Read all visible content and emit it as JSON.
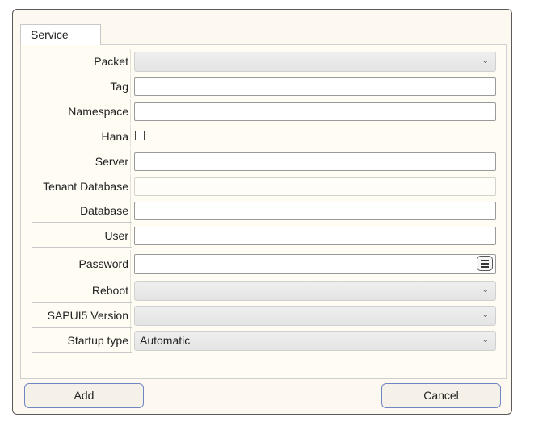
{
  "tabs": [
    {
      "label": "Service"
    }
  ],
  "form": {
    "packet": {
      "label": "Packet",
      "value": ""
    },
    "tag": {
      "label": "Tag",
      "value": ""
    },
    "namespace": {
      "label": "Namespace",
      "value": ""
    },
    "hana": {
      "label": "Hana",
      "checked": false
    },
    "server": {
      "label": "Server",
      "value": ""
    },
    "tenant_database": {
      "label": "Tenant Database",
      "value": ""
    },
    "database": {
      "label": "Database",
      "value": ""
    },
    "user": {
      "label": "User",
      "value": ""
    },
    "password": {
      "label": "Password",
      "value": ""
    },
    "reboot": {
      "label": "Reboot",
      "value": ""
    },
    "sapui5_version": {
      "label": "SAPUI5 Version",
      "value": ""
    },
    "startup_type": {
      "label": "Startup type",
      "value": "Automatic"
    }
  },
  "buttons": {
    "add": "Add",
    "cancel": "Cancel"
  },
  "icons": {
    "dropdown": "chevron-down-icon",
    "password_reveal": "menu-lines-icon"
  },
  "colors": {
    "dialog_bg": "#fdf9f0",
    "button_border": "#6f86c4"
  }
}
